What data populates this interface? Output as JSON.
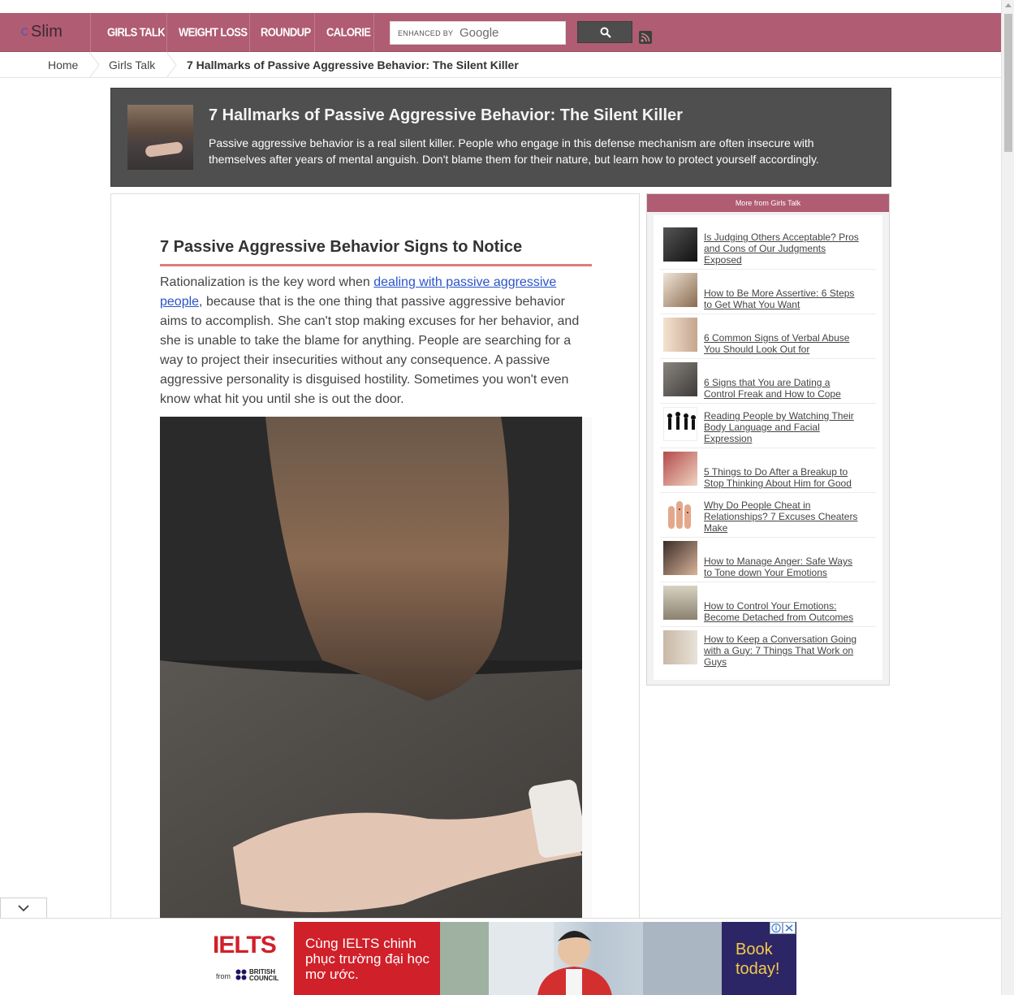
{
  "site": {
    "logo_text": "Slim"
  },
  "nav": {
    "items": [
      "GIRLS TALK",
      "WEIGHT LOSS",
      "ROUNDUP",
      "CALORIE"
    ],
    "search": {
      "enhanced_label": "ENHANCED BY",
      "brand": "Google",
      "placeholder": ""
    },
    "search_button_icon": "search-icon",
    "rss_icon": "rss-icon",
    "accent": "#b05c73"
  },
  "breadcrumb": {
    "items": [
      "Home",
      "Girls Talk"
    ],
    "current": "7 Hallmarks of Passive Aggressive Behavior: The Silent Killer"
  },
  "hero": {
    "title": "7 Hallmarks of Passive Aggressive Behavior: The Silent Killer",
    "description": "Passive aggressive behavior is a real silent killer. People who engage in this defense mechanism are often insecure with themselves after years of mental anguish. Don't blame them for their nature, but learn how to protect yourself accordingly."
  },
  "article": {
    "heading": "7 Passive Aggressive Behavior Signs to Notice",
    "para_before_link": "Rationalization is the key word when ",
    "link_text": "dealing with passive aggressive people",
    "para_after_link": ", because that is the one thing that passive aggressive behavior aims to accomplish. She can't stop making excuses for her behavior, and she is unable to take the blame for anything. People are searching for a way to project their insecurities without any consequence. A passive aggressive personality is disguised hostility. Sometimes you won't even know what hit you until she is out the door."
  },
  "sidebar": {
    "heading": "More from Girls Talk",
    "items": [
      {
        "label": "Is Judging Others Acceptable? Pros and Cons of Our Judgments Exposed"
      },
      {
        "label": "How to Be More Assertive: 6 Steps to Get What You Want"
      },
      {
        "label": "6 Common Signs of Verbal Abuse You Should Look Out for"
      },
      {
        "label": "6 Signs that You are Dating a Control Freak and How to Cope"
      },
      {
        "label": "Reading People by Watching Their Body Language and Facial Expression"
      },
      {
        "label": "5 Things to Do After a Breakup to Stop Thinking About Him for Good"
      },
      {
        "label": "Why Do People Cheat in Relationships? 7 Excuses Cheaters Make"
      },
      {
        "label": "How to Manage Anger: Safe Ways to Tone down Your Emotions"
      },
      {
        "label": "How to Control Your Emotions: Become Detached from Outcomes"
      },
      {
        "label": "How to Keep a Conversation Going with a Guy: 7 Things That Work on Guys"
      }
    ]
  },
  "ad": {
    "brand": "IELTS",
    "from": "from",
    "partner": "BRITISH COUNCIL",
    "tagline": "Cùng IELTS chinh phục trường đại học mơ ước.",
    "cta": "Book today!",
    "colors": {
      "red": "#d0202a",
      "navy": "#2c2666",
      "cta": "#f2c94c"
    }
  }
}
